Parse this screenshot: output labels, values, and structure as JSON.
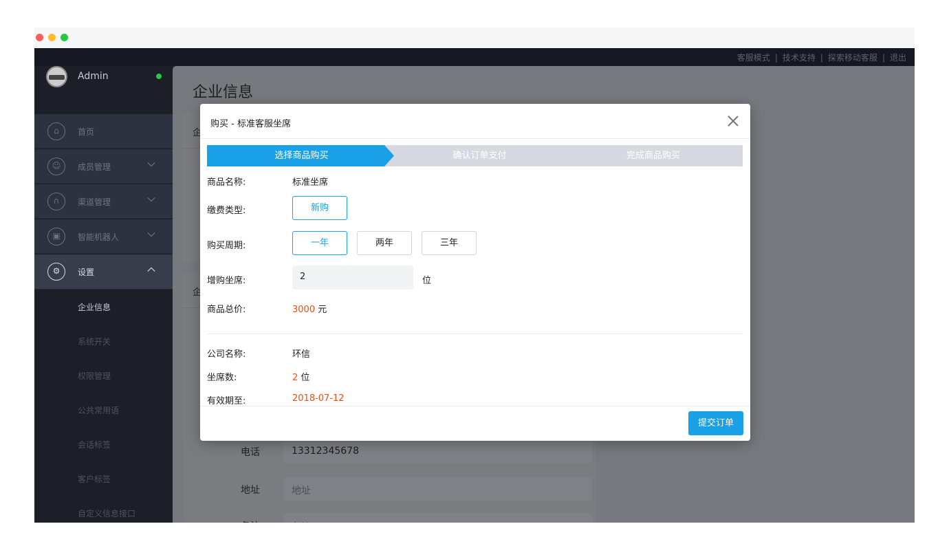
{
  "topnav": {
    "items": [
      "客服模式",
      "技术支持",
      "探索移动客服",
      "退出"
    ]
  },
  "sidebar": {
    "user": {
      "name": "Admin"
    },
    "menu": [
      {
        "label": "首页",
        "icon": "home-icon",
        "glyph": "⌂"
      },
      {
        "label": "成员管理",
        "icon": "user-icon",
        "glyph": "☺"
      },
      {
        "label": "渠道管理",
        "icon": "channel-icon",
        "glyph": "∩"
      },
      {
        "label": "智能机器人",
        "icon": "robot-icon",
        "glyph": "▣"
      },
      {
        "label": "设置",
        "icon": "gear-icon",
        "glyph": "⚙"
      }
    ],
    "submenu": [
      "企业信息",
      "系统开关",
      "权限管理",
      "公共常用语",
      "会话标签",
      "客户标签",
      "自定义信息接口"
    ]
  },
  "page": {
    "title": "企业信息",
    "card1_title": "企",
    "card2_title": "企",
    "phone_label": "电话",
    "phone_value": "13312345678",
    "address_label": "地址",
    "address_placeholder": "地址",
    "remark_label": "备注",
    "remark_placeholder": "备注"
  },
  "modal": {
    "title": "购买 - 标准客服坐席",
    "steps": [
      "选择商品购买",
      "确认订单支付",
      "完成商品购买"
    ],
    "product_name_label": "商品名称:",
    "product_name": "标准坐席",
    "fee_type_label": "缴费类型:",
    "fee_type_options": [
      "新购"
    ],
    "period_label": "购买周期:",
    "period_options": [
      "一年",
      "两年",
      "三年"
    ],
    "seats_label": "增购坐席:",
    "seats_value": "2",
    "seats_unit": "位",
    "total_label": "商品总价:",
    "total_value": "3000",
    "total_unit": "元",
    "company_label": "公司名称:",
    "company_value": "环信",
    "seat_count_label": "坐席数:",
    "seat_count_value": "2",
    "seat_count_unit": "位",
    "expiry_label": "有效期至:",
    "expiry_value": "2018-07-12",
    "submit_label": "提交订单"
  },
  "colors": {
    "accent": "#1aa0e6",
    "price": "#f04d0f",
    "online": "#2fc24a"
  }
}
